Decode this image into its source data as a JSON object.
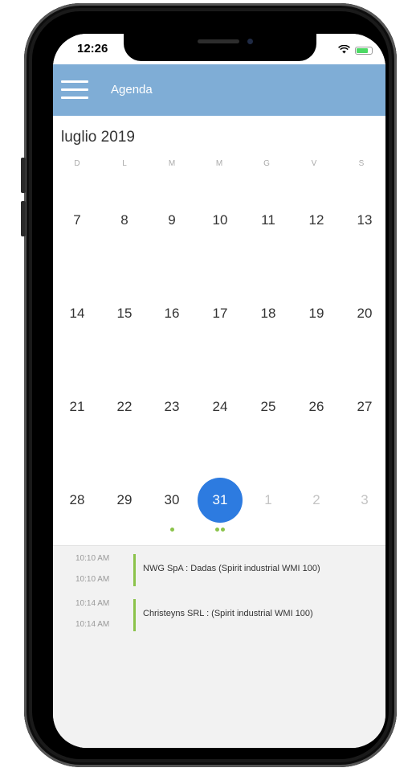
{
  "status_bar": {
    "time": "12:26"
  },
  "app_bar": {
    "title": "Agenda"
  },
  "calendar": {
    "month_title": "luglio 2019",
    "weekdays": [
      "D",
      "L",
      "M",
      "M",
      "G",
      "V",
      "S"
    ],
    "weeks": [
      [
        "7",
        "8",
        "9",
        "10",
        "11",
        "12",
        "13"
      ],
      [
        "14",
        "15",
        "16",
        "17",
        "18",
        "19",
        "20"
      ],
      [
        "21",
        "22",
        "23",
        "24",
        "25",
        "26",
        "27"
      ],
      [
        "28",
        "29",
        "30",
        "31",
        "1",
        "2",
        "3"
      ]
    ],
    "selected_day": "31",
    "event_dot_color": "#8bc34a",
    "selected_color": "#2d7be0"
  },
  "events": [
    {
      "start": "10:10 AM",
      "end": "10:10 AM",
      "title": "NWG SpA : Dadas (Spirit industrial WMI 100)"
    },
    {
      "start": "10:14 AM",
      "end": "10:14 AM",
      "title": "Christeyns SRL :  (Spirit industrial WMI 100)"
    }
  ],
  "colors": {
    "app_bar": "#7fadd6",
    "accent": "#8bc34a"
  }
}
